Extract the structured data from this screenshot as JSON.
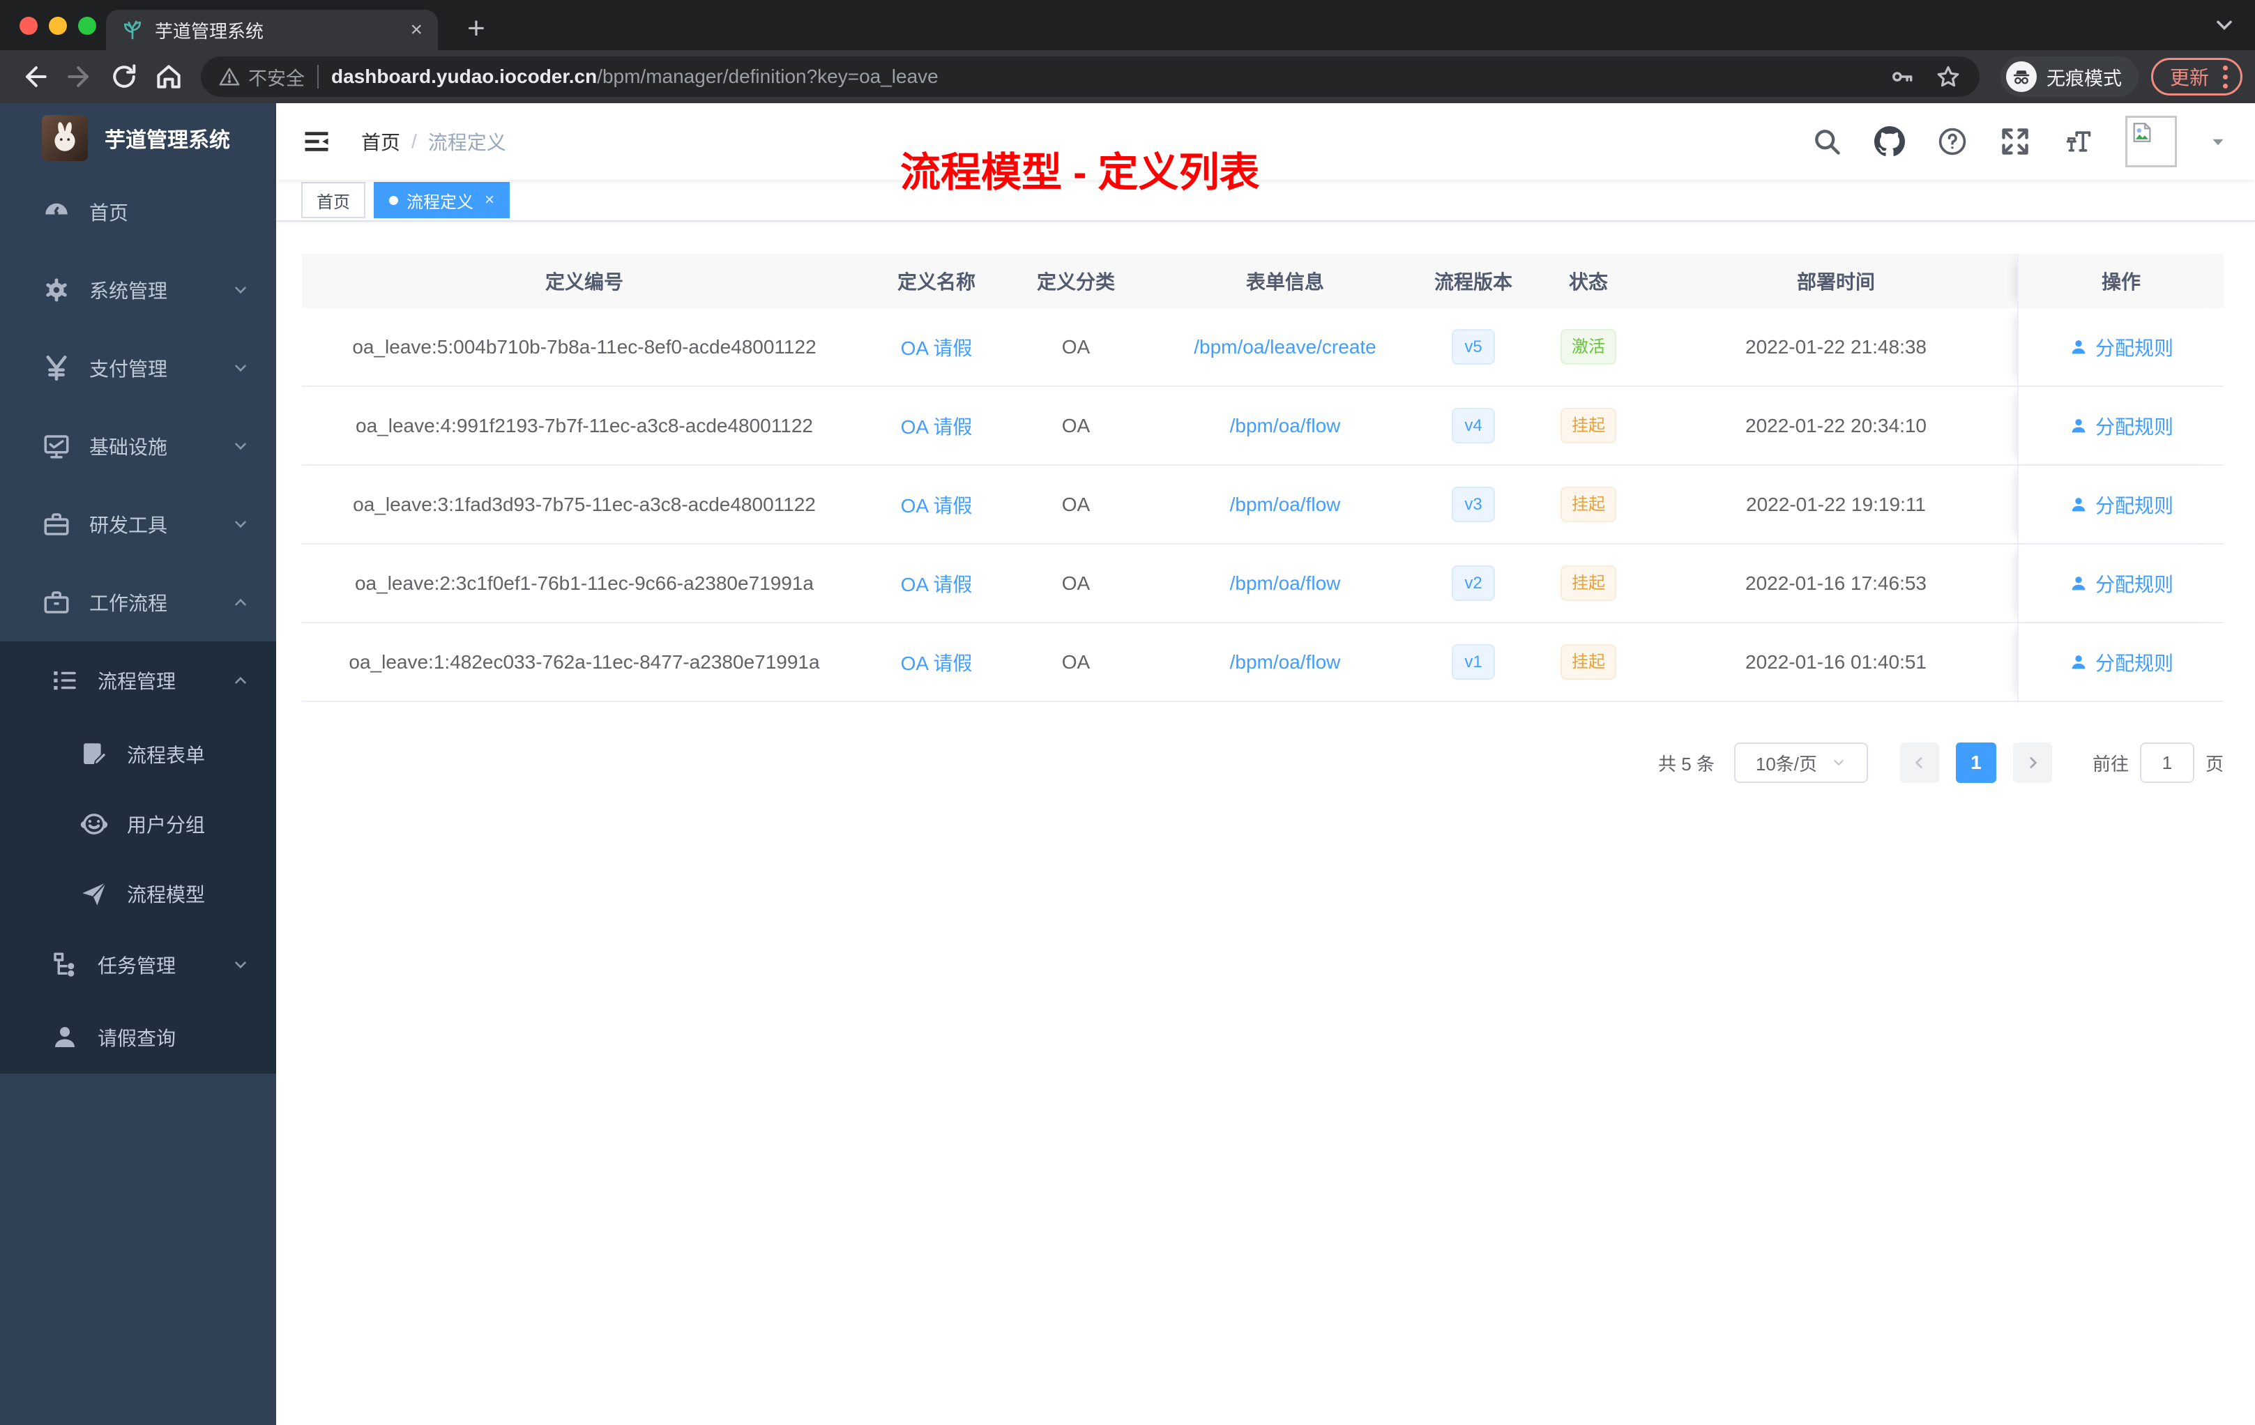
{
  "colors": {
    "accent_blue": "#409eff",
    "status_active_green": "#67c23a",
    "status_suspended_orange": "#e6a23c",
    "sidebar_bg": "#304156",
    "sidebar_submenu_bg": "#1f2d3d",
    "annotation_red": "#ff0000",
    "chrome_update_red": "#f28b82"
  },
  "browser": {
    "tab_title": "芋道管理系统",
    "security_label": "不安全",
    "url_host": "dashboard.yudao.iocoder.cn",
    "url_path": "/bpm/manager/definition?key=oa_leave",
    "incognito_label": "无痕模式",
    "update_label": "更新"
  },
  "sidebar": {
    "logo_title": "芋道管理系统",
    "items": [
      {
        "label": "首页"
      },
      {
        "label": "系统管理"
      },
      {
        "label": "支付管理"
      },
      {
        "label": "基础设施"
      },
      {
        "label": "研发工具"
      },
      {
        "label": "工作流程"
      },
      {
        "label": "流程管理"
      },
      {
        "label": "流程表单"
      },
      {
        "label": "用户分组"
      },
      {
        "label": "流程模型"
      },
      {
        "label": "任务管理"
      },
      {
        "label": "请假查询"
      }
    ]
  },
  "navbar": {
    "breadcrumb_home": "首页",
    "breadcrumb_current": "流程定义",
    "annotation": "流程模型 - 定义列表"
  },
  "tags": {
    "home": "首页",
    "current": "流程定义"
  },
  "table": {
    "columns": [
      "定义编号",
      "定义名称",
      "定义分类",
      "表单信息",
      "流程版本",
      "状态",
      "部署时间",
      "操作"
    ],
    "action_label": "分配规则",
    "rows": [
      {
        "id": "oa_leave:5:004b710b-7b8a-11ec-8ef0-acde48001122",
        "name": "OA 请假",
        "category": "OA",
        "form": "/bpm/oa/leave/create",
        "version": "v5",
        "status": "激活",
        "time": "2022-01-22 21:48:38"
      },
      {
        "id": "oa_leave:4:991f2193-7b7f-11ec-a3c8-acde48001122",
        "name": "OA 请假",
        "category": "OA",
        "form": "/bpm/oa/flow",
        "version": "v4",
        "status": "挂起",
        "time": "2022-01-22 20:34:10"
      },
      {
        "id": "oa_leave:3:1fad3d93-7b75-11ec-a3c8-acde48001122",
        "name": "OA 请假",
        "category": "OA",
        "form": "/bpm/oa/flow",
        "version": "v3",
        "status": "挂起",
        "time": "2022-01-22 19:19:11"
      },
      {
        "id": "oa_leave:2:3c1f0ef1-76b1-11ec-9c66-a2380e71991a",
        "name": "OA 请假",
        "category": "OA",
        "form": "/bpm/oa/flow",
        "version": "v2",
        "status": "挂起",
        "time": "2022-01-16 17:46:53"
      },
      {
        "id": "oa_leave:1:482ec033-762a-11ec-8477-a2380e71991a",
        "name": "OA 请假",
        "category": "OA",
        "form": "/bpm/oa/flow",
        "version": "v1",
        "status": "挂起",
        "time": "2022-01-16 01:40:51"
      }
    ]
  },
  "pagination": {
    "total": "共 5 条",
    "page_size": "10条/页",
    "current_page": "1",
    "goto_label": "前往",
    "goto_value": "1",
    "page_unit": "页"
  }
}
